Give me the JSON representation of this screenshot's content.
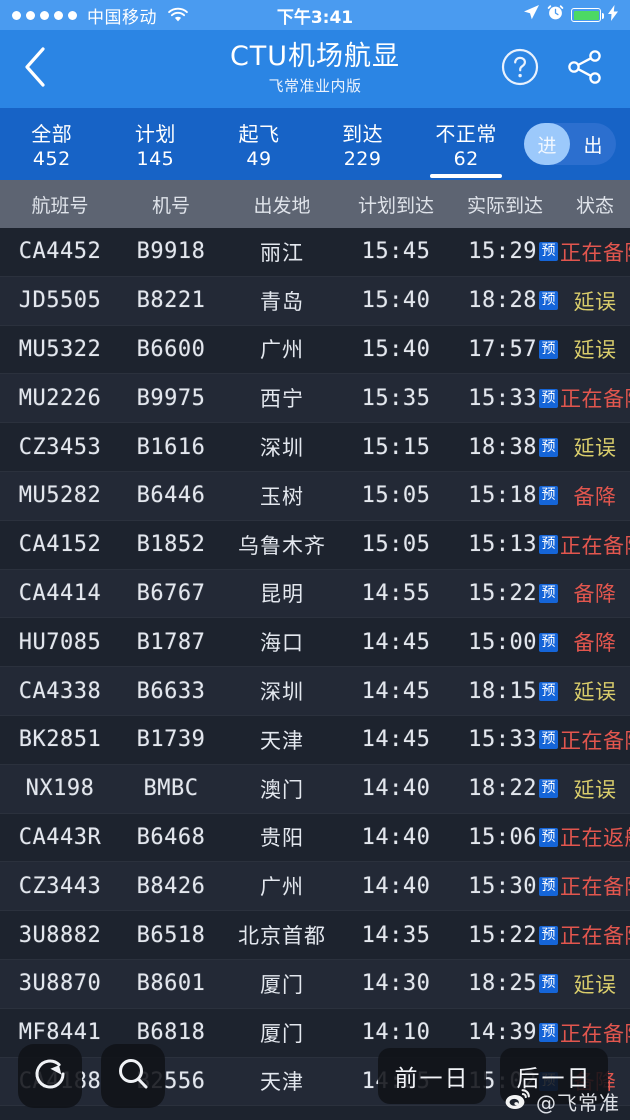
{
  "status_bar": {
    "signal_dots": 5,
    "carrier": "中国移动",
    "wifi_icon": "wifi-icon",
    "time": "下午3:41",
    "location_icon": "location-arrow-icon",
    "alarm_icon": "alarm-clock-icon",
    "battery_icon": "battery-icon",
    "charging_icon": "lightning-bolt-icon",
    "battery_color": "#4cd964"
  },
  "navbar": {
    "back_icon": "chevron-left-icon",
    "title": "CTU机场航显",
    "subtitle": "飞常准业内版",
    "help_icon": "question-mark-circle-icon",
    "share_icon": "share-icon",
    "bg_color": "#2b85e4"
  },
  "tabs": {
    "items": [
      {
        "label": "全部",
        "count": "452",
        "active": false
      },
      {
        "label": "计划",
        "count": "145",
        "active": false
      },
      {
        "label": "起飞",
        "count": "49",
        "active": false
      },
      {
        "label": "到达",
        "count": "229",
        "active": false
      },
      {
        "label": "不正常",
        "count": "62",
        "active": true
      }
    ],
    "toggle": {
      "left_label": "进",
      "right_label": "出",
      "selected": "进"
    },
    "bg_color": "#1763c6"
  },
  "table": {
    "headers": [
      "航班号",
      "机号",
      "出发地",
      "计划到达",
      "实际到达",
      "状态"
    ],
    "badge_label": "预",
    "status_colors": {
      "red": "#e2564e",
      "yellow": "#d8cc6b"
    },
    "rows": [
      {
        "flight": "CA4452",
        "reg": "B9918",
        "from": "丽江",
        "sched": "15:45",
        "actual": "15:29",
        "badge": "预",
        "status": "正在备降",
        "color": "red"
      },
      {
        "flight": "JD5505",
        "reg": "B8221",
        "from": "青岛",
        "sched": "15:40",
        "actual": "18:28",
        "badge": "预",
        "status": "延误",
        "color": "yellow"
      },
      {
        "flight": "MU5322",
        "reg": "B6600",
        "from": "广州",
        "sched": "15:40",
        "actual": "17:57",
        "badge": "预",
        "status": "延误",
        "color": "yellow"
      },
      {
        "flight": "MU2226",
        "reg": "B9975",
        "from": "西宁",
        "sched": "15:35",
        "actual": "15:33",
        "badge": "预",
        "status": "正在备降",
        "color": "red"
      },
      {
        "flight": "CZ3453",
        "reg": "B1616",
        "from": "深圳",
        "sched": "15:15",
        "actual": "18:38",
        "badge": "预",
        "status": "延误",
        "color": "yellow"
      },
      {
        "flight": "MU5282",
        "reg": "B6446",
        "from": "玉树",
        "sched": "15:05",
        "actual": "15:18",
        "badge": "预",
        "status": "备降",
        "color": "red"
      },
      {
        "flight": "CA4152",
        "reg": "B1852",
        "from": "乌鲁木齐",
        "sched": "15:05",
        "actual": "15:13",
        "badge": "预",
        "status": "正在备降",
        "color": "red"
      },
      {
        "flight": "CA4414",
        "reg": "B6767",
        "from": "昆明",
        "sched": "14:55",
        "actual": "15:22",
        "badge": "预",
        "status": "备降",
        "color": "red"
      },
      {
        "flight": "HU7085",
        "reg": "B1787",
        "from": "海口",
        "sched": "14:45",
        "actual": "15:00",
        "badge": "预",
        "status": "备降",
        "color": "red"
      },
      {
        "flight": "CA4338",
        "reg": "B6633",
        "from": "深圳",
        "sched": "14:45",
        "actual": "18:15",
        "badge": "预",
        "status": "延误",
        "color": "yellow"
      },
      {
        "flight": "BK2851",
        "reg": "B1739",
        "from": "天津",
        "sched": "14:45",
        "actual": "15:33",
        "badge": "预",
        "status": "正在备降",
        "color": "red"
      },
      {
        "flight": "NX198",
        "reg": "BMBC",
        "from": "澳门",
        "sched": "14:40",
        "actual": "18:22",
        "badge": "预",
        "status": "延误",
        "color": "yellow"
      },
      {
        "flight": "CA443R",
        "reg": "B6468",
        "from": "贵阳",
        "sched": "14:40",
        "actual": "15:06",
        "badge": "预",
        "status": "正在返航",
        "color": "red"
      },
      {
        "flight": "CZ3443",
        "reg": "B8426",
        "from": "广州",
        "sched": "14:40",
        "actual": "15:30",
        "badge": "预",
        "status": "正在备降",
        "color": "red"
      },
      {
        "flight": "3U8882",
        "reg": "B6518",
        "from": "北京首都",
        "sched": "14:35",
        "actual": "15:22",
        "badge": "预",
        "status": "正在备降",
        "color": "red"
      },
      {
        "flight": "3U8870",
        "reg": "B8601",
        "from": "厦门",
        "sched": "14:30",
        "actual": "18:25",
        "badge": "预",
        "status": "延误",
        "color": "yellow"
      },
      {
        "flight": "MF8441",
        "reg": "B6818",
        "from": "厦门",
        "sched": "14:10",
        "actual": "14:39",
        "badge": "预",
        "status": "正在备降",
        "color": "red"
      },
      {
        "flight": "CA4188",
        "reg": "B2556",
        "from": "天津",
        "sched": "14:05",
        "actual": "15:02",
        "badge": "预",
        "status": "备降",
        "color": "red"
      }
    ]
  },
  "floating": {
    "refresh_icon": "refresh-icon",
    "search_icon": "search-icon",
    "prev_day_label": "前一日",
    "next_day_label": "后一日"
  },
  "watermark": {
    "icon": "weibo-icon",
    "text": "@飞常准"
  }
}
